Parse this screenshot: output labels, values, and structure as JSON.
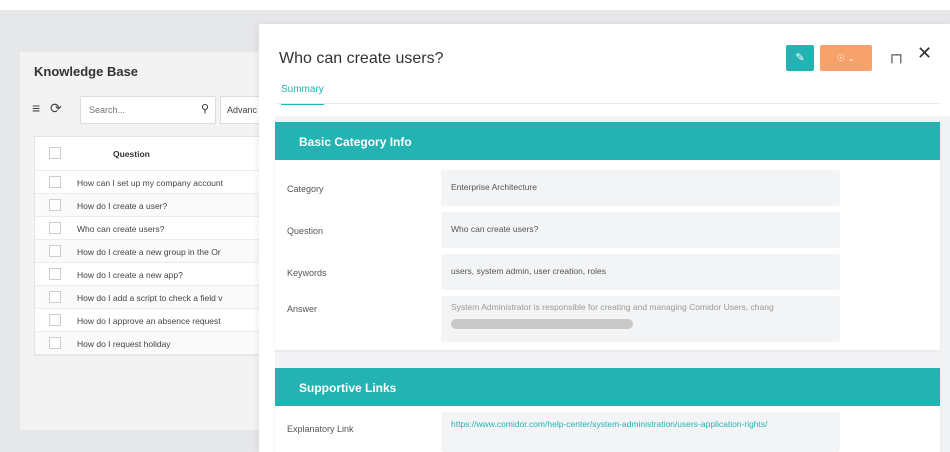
{
  "background_app": {
    "title": "Knowledge Base",
    "search_placeholder": "Search...",
    "advanced_label": "Advanc",
    "column_header": "Question",
    "rows": [
      "How can I set up my company account",
      "How do I create a user?",
      "Who can create users?",
      "How do I create a new group in the Or",
      "How do I create a new app?",
      "How do I add a script to check a field v",
      "How do I approve an absence request",
      "How do I request holiday"
    ]
  },
  "drawer": {
    "title": "Who can create users?",
    "tabs": [
      "Summary"
    ],
    "sections": [
      {
        "header": "Basic Category Info",
        "fields": [
          {
            "label": "Category",
            "value": "Enterprise Architecture"
          },
          {
            "label": "Question",
            "value": "Who can create users?"
          },
          {
            "label": "Keywords",
            "value": "users, system admin, user creation, roles"
          },
          {
            "label": "Answer",
            "value": "System Administrator is responsible for creating and managing Comidor Users, chang"
          }
        ]
      },
      {
        "header": "Supportive Links",
        "fields": [
          {
            "label": "Explanatory Link",
            "value": "https://www.comidor.com/help-center/system-administration/users-application-rights/"
          }
        ]
      }
    ]
  },
  "colors": {
    "accent": "#23b3b3",
    "orange": "#f7a26a"
  },
  "icons": {
    "menu": "hamburger-icon",
    "refresh": "refresh-icon",
    "search": "search-icon",
    "edit": "pencil-icon",
    "expand": "expand-icon",
    "close": "close-icon"
  }
}
